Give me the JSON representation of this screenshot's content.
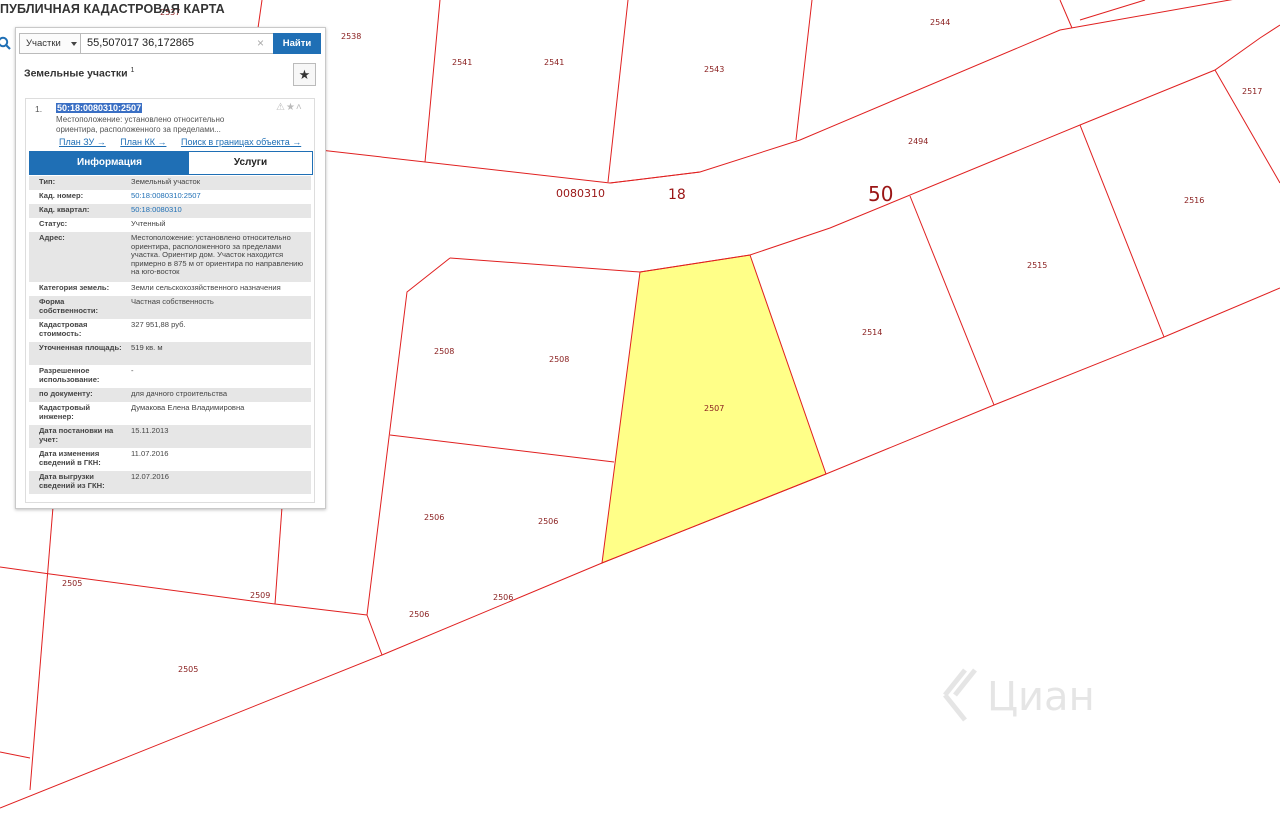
{
  "app": {
    "title": "ПУБЛИЧНАЯ КАДАСТРОВАЯ КАРТА"
  },
  "search": {
    "type_label": "Участки",
    "value": "55,507017 36,172865",
    "clear_symbol": "×",
    "button_label": "Найти"
  },
  "results": {
    "title": "Земельные участки",
    "count": "1",
    "fav_symbol": "★"
  },
  "item": {
    "index": "1.",
    "cad_number": "50:18:0080310:2507",
    "location_short_1": "Местоположение: установлено относительно",
    "location_short_2": "ориентира, расположенного за пределами...",
    "icons": "⚠★˄",
    "links": {
      "plan_zu": "План ЗУ →",
      "plan_kk": "План КК →",
      "search_bounds": "Поиск в границах объекта →"
    },
    "tabs": {
      "info": "Информация",
      "services": "Услуги"
    }
  },
  "details": [
    {
      "label": "Тип:",
      "value": "Земельный участок"
    },
    {
      "label": "Кад. номер:",
      "value": "50:18:0080310:2507",
      "link": true
    },
    {
      "label": "Кад. квартал:",
      "value": "50:18:0080310",
      "link": true
    },
    {
      "label": "Статус:",
      "value": "Учтенный"
    },
    {
      "label": "Адрес:",
      "value": "Местоположение: установлено относительно ориентира, расположенного за пределами участка. Ориентир дом. Участок находится примерно в 875 м от ориентира по направлению на юго-восток"
    },
    {
      "label": "Категория земель:",
      "value": "Земли сельскохозяйственного назначения"
    },
    {
      "label": "Форма собственности:",
      "value": "Частная собственность"
    },
    {
      "label": "Кадастровая стоимость:",
      "value": "327 951,88 руб."
    },
    {
      "label": "Уточненная площадь:",
      "value": "519 кв. м"
    },
    {
      "label": "Разрешенное использование:",
      "value": "-"
    },
    {
      "label": "по документу:",
      "value": "для дачного строительства"
    },
    {
      "label": "Кадастровый инженер:",
      "value": "Думакова Елена Владимировна"
    },
    {
      "label": "Дата постановки на учет:",
      "value": "15.11.2013"
    },
    {
      "label": "Дата изменения сведений в ГКН:",
      "value": "11.07.2016"
    },
    {
      "label": "Дата выгрузки сведений из ГКН:",
      "value": "12.07.2016"
    }
  ],
  "map": {
    "quarter_label": "0080310",
    "district_label": "18",
    "region_label": "50",
    "selected_parcel": "2507",
    "parcel_labels": {
      "p2538": "2538",
      "p2541a": "2541",
      "p2541b": "2541",
      "p2543": "2543",
      "p2544": "2544",
      "p2517": "2517",
      "p2494": "2494",
      "p2516": "2516",
      "p2515": "2515",
      "p2514": "2514",
      "p2508a": "2508",
      "p2508b": "2508",
      "p2506a": "2506",
      "p2506b": "2506",
      "p2506c": "2506",
      "p2506d": "2506",
      "p2505a": "2505",
      "p2505b": "2505",
      "p2509": "2509",
      "p2537": "2537"
    },
    "selected_fill": "#ffff88",
    "boundary_color": "#e02020"
  },
  "watermark": {
    "text": "Циан"
  }
}
